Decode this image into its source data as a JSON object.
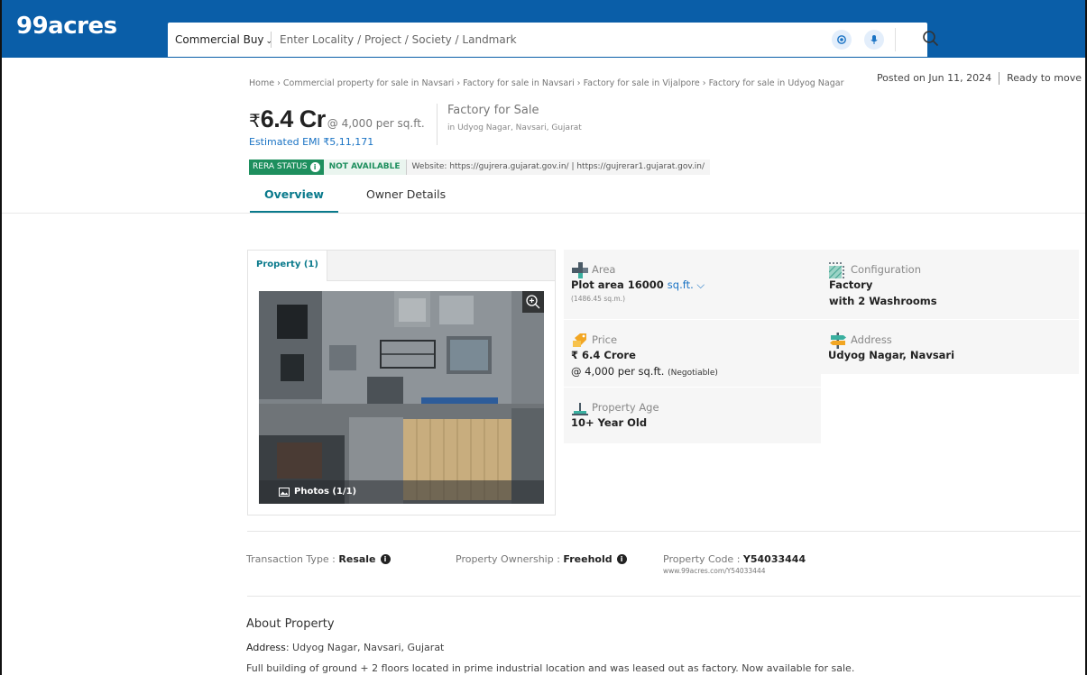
{
  "header": {
    "logo": "99acres",
    "category": "Commercial Buy",
    "search_placeholder": "Enter Locality / Project / Society / Landmark"
  },
  "meta": {
    "posted": "Posted on Jun 11, 2024",
    "status": "Ready to move"
  },
  "breadcrumb": [
    "Home",
    "Commercial property for sale in Navsari",
    "Factory for sale in Navsari",
    "Factory for sale in Vijalpore",
    "Factory for sale in Udyog Nagar"
  ],
  "breadcrumb_sep": "›",
  "price": {
    "currency": "₹",
    "amount": "6.4 Cr",
    "rate": "@ 4,000 per sq.ft.",
    "emi": "Estimated EMI ₹5,11,171"
  },
  "title": {
    "main": "Factory for Sale",
    "sub": "in Udyog Nagar, Navsari, Gujarat"
  },
  "rera": {
    "label": "RERA STATUS",
    "value": "NOT AVAILABLE",
    "website": "Website: https://gujrera.gujarat.gov.in/ | https://gujrerar1.gujarat.gov.in/"
  },
  "tabs": [
    {
      "label": "Overview",
      "active": true
    },
    {
      "label": "Owner Details",
      "active": false
    }
  ],
  "gallery": {
    "tab": "Property (1)",
    "photos_label": "Photos (1/1)"
  },
  "details": {
    "area": {
      "label": "Area",
      "value": "Plot area 16000",
      "unit": "sq.ft.",
      "sub": "(1486.45 sq.m.)"
    },
    "configuration": {
      "label": "Configuration",
      "value": "Factory",
      "value2": "with 2 Washrooms"
    },
    "price": {
      "label": "Price",
      "value": "₹ 6.4 Crore",
      "rate": "@ 4,000 per sq.ft.",
      "negotiable": "(Negotiable)"
    },
    "address": {
      "label": "Address",
      "value": "Udyog Nagar, Navsari"
    },
    "age": {
      "label": "Property Age",
      "value": "10+ Year Old"
    }
  },
  "info": {
    "transaction_label": "Transaction Type : ",
    "transaction_value": "Resale",
    "ownership_label": "Property Ownership : ",
    "ownership_value": "Freehold",
    "code_label": "Property Code : ",
    "code_value": "Y54033444",
    "code_url": "www.99acres.com/Y54033444"
  },
  "about": {
    "heading": "About Property",
    "address_label": "Address",
    "address_value": ": Udyog Nagar, Navsari, Gujarat",
    "description": "Full building of ground + 2 floors located in prime industrial location and was leased out as factory. Now available for sale."
  },
  "colors": {
    "brand": "#0a5ea8",
    "accent": "#0a7a8c",
    "rera_green": "#1e8f5e",
    "link": "#1a73c4"
  }
}
